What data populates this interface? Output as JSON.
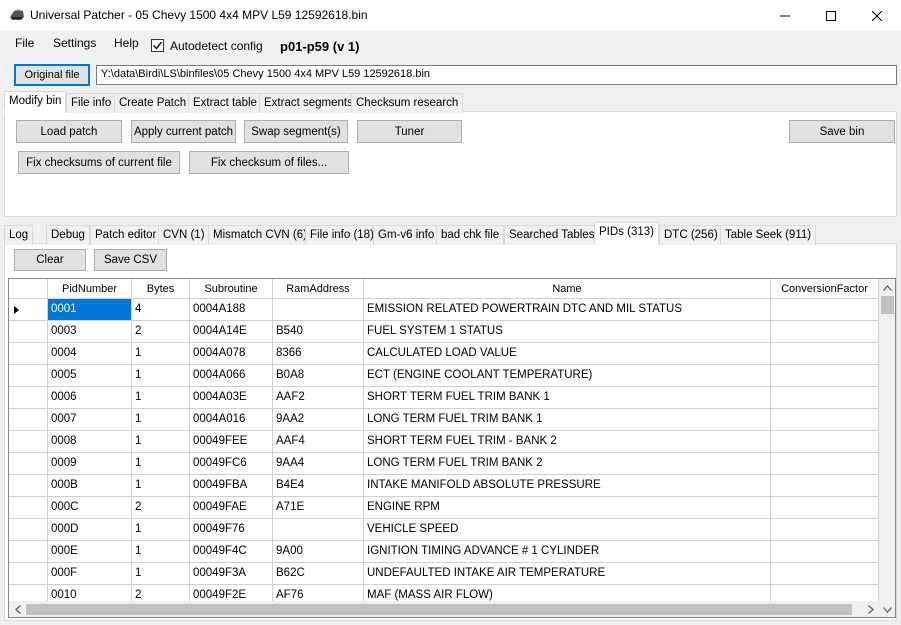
{
  "window": {
    "title": "Universal Patcher - 05 Chevy 1500 4x4 MPV L59 12592618.bin",
    "minimize_glyph": "—",
    "maximize_glyph": "☐",
    "close_glyph": "✕"
  },
  "menu": {
    "file": "File",
    "settings": "Settings",
    "help": "Help",
    "autodetect_label": "Autodetect config",
    "autodetect_checked": true,
    "version": "p01-p59 (v 1)"
  },
  "file_row": {
    "button_label": "Original file",
    "path": "Y:\\data\\Birdi\\LS\\binfiles\\05 Chevy 1500 4x4 MPV L59 12592618.bin"
  },
  "top_tabs": [
    "Modify bin",
    "File info",
    "Create Patch",
    "Extract table",
    "Extract segments",
    "Checksum research"
  ],
  "modify_bin": {
    "load_patch": "Load patch",
    "apply_current_patch": "Apply current patch",
    "swap_segments": "Swap segment(s)",
    "tuner": "Tuner",
    "save_bin": "Save bin",
    "fix_checksums_current": "Fix checksums of current file",
    "fix_checksum_files": "Fix checksum of files..."
  },
  "bottom_tabs": [
    "Log",
    "Debug",
    "Patch editor",
    "CVN (1)",
    "Mismatch CVN (6)",
    "File info (18)",
    "Gm-v6 info",
    "bad chk file",
    "Searched Tables",
    "PIDs (313)",
    "DTC (256)",
    "Table Seek (911)"
  ],
  "pids_panel": {
    "clear": "Clear",
    "save_csv": "Save CSV"
  },
  "grid": {
    "columns": [
      "PidNumber",
      "Bytes",
      "Subroutine",
      "RamAddress",
      "Name",
      "ConversionFactor"
    ],
    "rows": [
      [
        "0001",
        "4",
        "0004A188",
        "",
        "EMISSION RELATED POWERTRAIN DTC AND MIL STATUS",
        ""
      ],
      [
        "0003",
        "2",
        "0004A14E",
        "B540",
        "FUEL SYSTEM 1 STATUS",
        ""
      ],
      [
        "0004",
        "1",
        "0004A078",
        "8366",
        "CALCULATED LOAD VALUE",
        ""
      ],
      [
        "0005",
        "1",
        "0004A066",
        "B0A8",
        "ECT (ENGINE COOLANT TEMPERATURE)",
        ""
      ],
      [
        "0006",
        "1",
        "0004A03E",
        "AAF2",
        "SHORT TERM FUEL TRIM BANK 1",
        ""
      ],
      [
        "0007",
        "1",
        "0004A016",
        "9AA2",
        "LONG TERM FUEL TRIM BANK 1",
        ""
      ],
      [
        "0008",
        "1",
        "00049FEE",
        "AAF4",
        "SHORT TERM FUEL TRIM - BANK 2",
        ""
      ],
      [
        "0009",
        "1",
        "00049FC6",
        "9AA4",
        "LONG TERM FUEL TRIM BANK 2",
        ""
      ],
      [
        "000B",
        "1",
        "00049FBA",
        "B4E4",
        "INTAKE MANIFOLD ABSOLUTE PRESSURE",
        ""
      ],
      [
        "000C",
        "2",
        "00049FAE",
        "A71E",
        "ENGINE RPM",
        ""
      ],
      [
        "000D",
        "1",
        "00049F76",
        "",
        "VEHICLE SPEED",
        ""
      ],
      [
        "000E",
        "1",
        "00049F4C",
        "9A00",
        "IGNITION TIMING ADVANCE # 1 CYLINDER",
        ""
      ],
      [
        "000F",
        "1",
        "00049F3A",
        "B62C",
        "UNDEFAULTED INTAKE AIR TEMPERATURE",
        ""
      ],
      [
        "0010",
        "2",
        "00049F2E",
        "AF76",
        "MAF (MASS AIR FLOW)",
        ""
      ]
    ]
  },
  "colors": {
    "selection": "#0078d7",
    "focus_border": "#0078d7"
  }
}
